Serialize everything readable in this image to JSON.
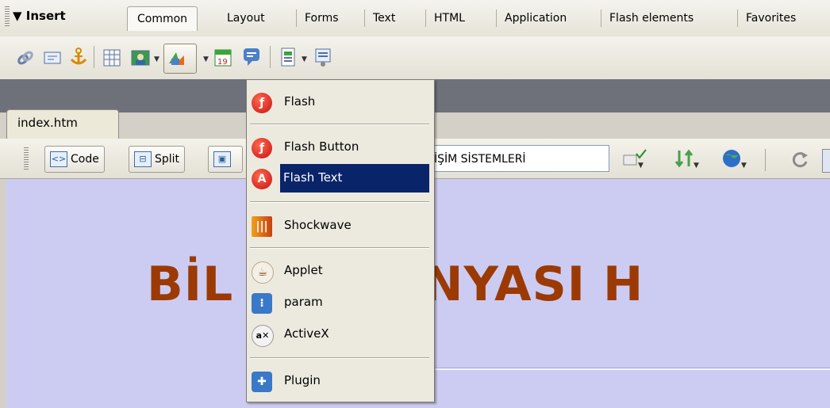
{
  "insert_bar": {
    "label": "▼ Insert",
    "tabs": [
      "Common",
      "Layout",
      "Forms",
      "Text",
      "HTML",
      "Application",
      "Flash elements",
      "Favorites"
    ]
  },
  "toolbar": {
    "icons": [
      "hyperlink-icon",
      "email-link-icon",
      "named-anchor-icon",
      "table-icon",
      "image-icon",
      "media-icon",
      "date-icon",
      "comment-icon",
      "templates-icon",
      "tag-chooser-icon"
    ]
  },
  "document": {
    "tab_label": "index.htm",
    "code_label": "Code",
    "split_label": "Split",
    "title_value": "İŞİM SİSTEMLERİ",
    "heading": "BİL      AR DÜNYASI H"
  },
  "menu": {
    "items": [
      {
        "label": "Flash",
        "icon": "flash-icon"
      },
      {
        "label": "Flash Button",
        "icon": "flash-button-icon"
      },
      {
        "label": "Flash Text",
        "icon": "flash-text-icon",
        "highlighted": true
      },
      {
        "label": "Shockwave",
        "icon": "shockwave-icon"
      },
      {
        "label": "Applet",
        "icon": "applet-icon"
      },
      {
        "label": "param",
        "icon": "param-icon"
      },
      {
        "label": "ActiveX",
        "icon": "activex-icon"
      },
      {
        "label": "Plugin",
        "icon": "plugin-icon"
      }
    ]
  },
  "colors": {
    "heading": "#9c3a05",
    "highlight": "#0a246a",
    "design_bg": "#ccccf2"
  }
}
